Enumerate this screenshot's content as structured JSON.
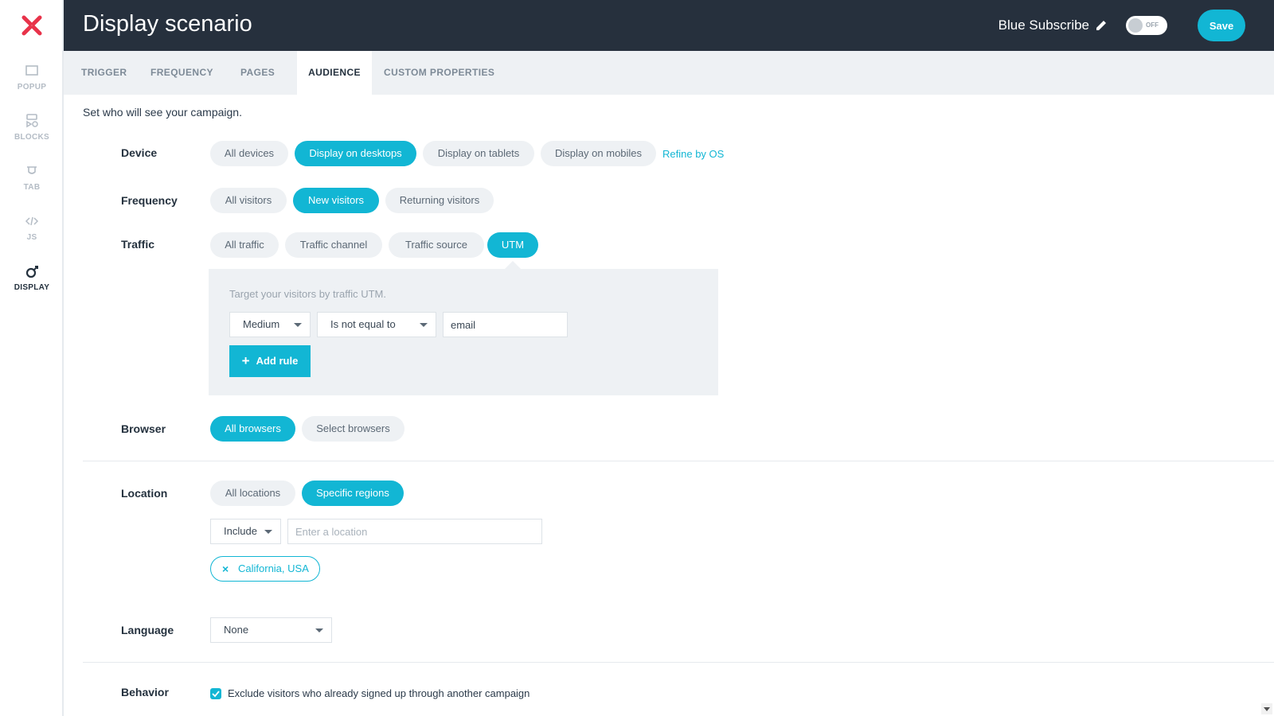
{
  "sidebar": {
    "logo": "close-x-logo",
    "items": [
      {
        "label": "POPUP",
        "icon": "popup-icon"
      },
      {
        "label": "BLOCKS",
        "icon": "blocks-icon"
      },
      {
        "label": "TAB",
        "icon": "tab-icon"
      },
      {
        "label": "JS",
        "icon": "code-icon"
      },
      {
        "label": "DISPLAY",
        "icon": "display-icon",
        "active": true
      }
    ]
  },
  "header": {
    "title": "Display scenario",
    "campaign_name": "Blue Subscribe",
    "toggle_label": "OFF",
    "save_label": "Save"
  },
  "tabs": [
    {
      "label": "TRIGGER"
    },
    {
      "label": "FREQUENCY"
    },
    {
      "label": "PAGES"
    },
    {
      "label": "AUDIENCE",
      "active": true
    },
    {
      "label": "CUSTOM PROPERTIES"
    }
  ],
  "intro": "Set who will see your campaign.",
  "device": {
    "label": "Device",
    "options": [
      "All devices",
      "Display on desktops",
      "Display on tablets",
      "Display on mobiles"
    ],
    "selected": "Display on desktops",
    "refine_link": "Refine by OS"
  },
  "frequency": {
    "label": "Frequency",
    "options": [
      "All visitors",
      "New visitors",
      "Returning visitors"
    ],
    "selected": "New visitors"
  },
  "traffic": {
    "label": "Traffic",
    "options": [
      "All traffic",
      "Traffic channel",
      "Traffic source",
      "UTM"
    ],
    "selected": "UTM",
    "utm": {
      "hint": "Target your visitors by traffic UTM.",
      "param_select": "Medium",
      "operator_select": "Is not equal to",
      "value": "email",
      "add_rule_label": "Add rule"
    }
  },
  "browser": {
    "label": "Browser",
    "options": [
      "All browsers",
      "Select browsers"
    ],
    "selected": "All browsers"
  },
  "location": {
    "label": "Location",
    "options": [
      "All locations",
      "Specific regions"
    ],
    "selected": "Specific regions",
    "mode_select": "Include",
    "input_placeholder": "Enter a location",
    "tags": [
      "California, USA"
    ]
  },
  "language": {
    "label": "Language",
    "selected": "None"
  },
  "behavior": {
    "label": "Behavior",
    "checkbox_label": "Exclude visitors who already signed up through another campaign",
    "checked": true
  },
  "colors": {
    "accent": "#12b6d4",
    "header_bg": "#26303d",
    "pill_bg": "#eef1f4",
    "brand_red": "#e8334a"
  }
}
